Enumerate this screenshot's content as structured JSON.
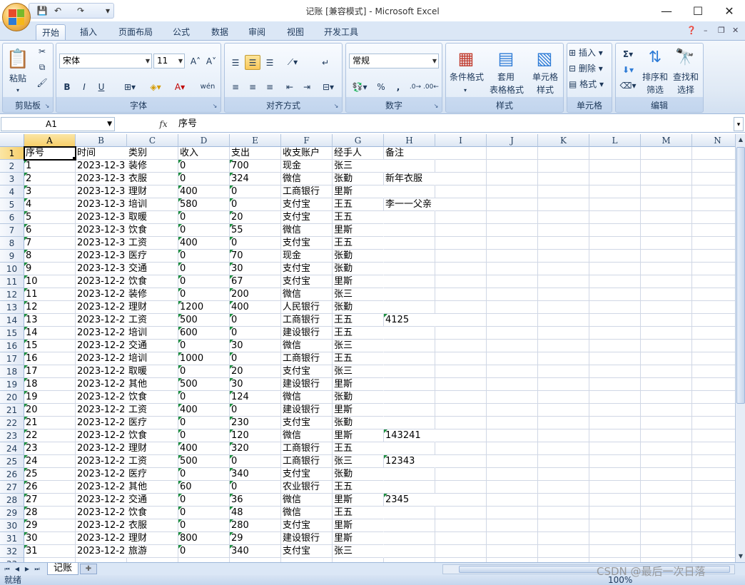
{
  "window": {
    "title": "记账  [兼容模式] - Microsoft Excel",
    "controls": {
      "minimize": "—",
      "maximize": "☐",
      "close": "✕"
    }
  },
  "qat": {
    "save": "💾",
    "undo": "↶",
    "redo": "↷",
    "customize": "▾"
  },
  "tabs": [
    {
      "label": "开始",
      "active": true
    },
    {
      "label": "插入"
    },
    {
      "label": "页面布局"
    },
    {
      "label": "公式"
    },
    {
      "label": "数据"
    },
    {
      "label": "审阅"
    },
    {
      "label": "视图"
    },
    {
      "label": "开发工具"
    }
  ],
  "ribbon": {
    "clipboard": {
      "label": "剪贴板",
      "paste": "粘贴"
    },
    "font": {
      "label": "字体",
      "name": "宋体",
      "size": "11"
    },
    "alignment": {
      "label": "对齐方式"
    },
    "number": {
      "label": "数字",
      "format": "常规",
      "percent": "%",
      "comma": ","
    },
    "styles": {
      "label": "样式",
      "conditional": "条件格式",
      "table_1": "套用",
      "table_2": "表格格式",
      "cell_1": "单元格",
      "cell_2": "样式"
    },
    "cells": {
      "label": "单元格",
      "insert": "插入",
      "delete": "删除",
      "format": "格式"
    },
    "editing": {
      "label": "编辑",
      "sort_1": "排序和",
      "sort_2": "筛选",
      "find_1": "查找和",
      "find_2": "选择"
    }
  },
  "formula_bar": {
    "name_box": "A1",
    "fx": "fx",
    "content": "序号"
  },
  "columns": [
    "A",
    "B",
    "C",
    "D",
    "E",
    "F",
    "G",
    "H",
    "I",
    "J",
    "K",
    "L",
    "M",
    "N"
  ],
  "header_row": [
    "序号",
    "时间",
    "类别",
    "收入",
    "支出",
    "收支账户",
    "经手人",
    "备注"
  ],
  "rows": [
    [
      "1",
      "2023-12-3",
      "装修",
      "0",
      "700",
      "现金",
      "张三",
      ""
    ],
    [
      "2",
      "2023-12-3",
      "衣服",
      "0",
      "324",
      "微信",
      "张勤",
      "新年衣服"
    ],
    [
      "3",
      "2023-12-3",
      "理财",
      "400",
      "0",
      "工商银行",
      "里斯",
      ""
    ],
    [
      "4",
      "2023-12-3",
      "培训",
      "580",
      "0",
      "支付宝",
      "王五",
      "李一一父亲"
    ],
    [
      "5",
      "2023-12-3",
      "取暖",
      "0",
      "20",
      "支付宝",
      "王五",
      ""
    ],
    [
      "6",
      "2023-12-3",
      "饮食",
      "0",
      "55",
      "微信",
      "里斯",
      ""
    ],
    [
      "7",
      "2023-12-3",
      "工资",
      "400",
      "0",
      "支付宝",
      "王五",
      ""
    ],
    [
      "8",
      "2023-12-3",
      "医疗",
      "0",
      "70",
      "现金",
      "张勤",
      ""
    ],
    [
      "9",
      "2023-12-3",
      "交通",
      "0",
      "30",
      "支付宝",
      "张勤",
      ""
    ],
    [
      "10",
      "2023-12-2",
      "饮食",
      "0",
      "67",
      "支付宝",
      "里斯",
      ""
    ],
    [
      "11",
      "2023-12-2",
      "装修",
      "0",
      "200",
      "微信",
      "张三",
      ""
    ],
    [
      "12",
      "2023-12-2",
      "理财",
      "1200",
      "400",
      "人民银行",
      "张勤",
      ""
    ],
    [
      "13",
      "2023-12-2",
      "工资",
      "500",
      "0",
      "工商银行",
      "王五",
      "4125"
    ],
    [
      "14",
      "2023-12-2",
      "培训",
      "600",
      "0",
      "建设银行",
      "王五",
      ""
    ],
    [
      "15",
      "2023-12-2",
      "交通",
      "0",
      "30",
      "微信",
      "张三",
      ""
    ],
    [
      "16",
      "2023-12-2",
      "培训",
      "1000",
      "0",
      "工商银行",
      "王五",
      ""
    ],
    [
      "17",
      "2023-12-2",
      "取暖",
      "0",
      "20",
      "支付宝",
      "张三",
      ""
    ],
    [
      "18",
      "2023-12-2",
      "其他",
      "500",
      "30",
      "建设银行",
      "里斯",
      ""
    ],
    [
      "19",
      "2023-12-2",
      "饮食",
      "0",
      "124",
      "微信",
      "张勤",
      ""
    ],
    [
      "20",
      "2023-12-2",
      "工资",
      "400",
      "0",
      "建设银行",
      "里斯",
      ""
    ],
    [
      "21",
      "2023-12-2",
      "医疗",
      "0",
      "230",
      "支付宝",
      "张勤",
      ""
    ],
    [
      "22",
      "2023-12-2",
      "饮食",
      "0",
      "120",
      "微信",
      "里斯",
      "143241"
    ],
    [
      "23",
      "2023-12-2",
      "理财",
      "400",
      "320",
      "工商银行",
      "王五",
      ""
    ],
    [
      "24",
      "2023-12-2",
      "工资",
      "500",
      "0",
      "工商银行",
      "张三",
      "12343"
    ],
    [
      "25",
      "2023-12-2",
      "医疗",
      "0",
      "340",
      "支付宝",
      "张勤",
      ""
    ],
    [
      "26",
      "2023-12-2",
      "其他",
      "60",
      "0",
      "农业银行",
      "王五",
      ""
    ],
    [
      "27",
      "2023-12-2",
      "交通",
      "0",
      "36",
      "微信",
      "里斯",
      "2345"
    ],
    [
      "28",
      "2023-12-2",
      "饮食",
      "0",
      "48",
      "微信",
      "王五",
      ""
    ],
    [
      "29",
      "2023-12-2",
      "衣服",
      "0",
      "280",
      "支付宝",
      "里斯",
      ""
    ],
    [
      "30",
      "2023-12-2",
      "理财",
      "800",
      "29",
      "建设银行",
      "里斯",
      ""
    ],
    [
      "31",
      "2023-12-2",
      "旅游",
      "0",
      "340",
      "支付宝",
      "张三",
      ""
    ]
  ],
  "sheet_tabs": [
    "记账"
  ],
  "status": {
    "ready": "就绪",
    "zoom": "100%"
  },
  "watermark": "CSDN @最后一次日落",
  "colors": {
    "ribbon_bg": "#dfe9f5",
    "selected_header": "#f7cf6a",
    "text_number_marker": "#1e8f3e"
  }
}
